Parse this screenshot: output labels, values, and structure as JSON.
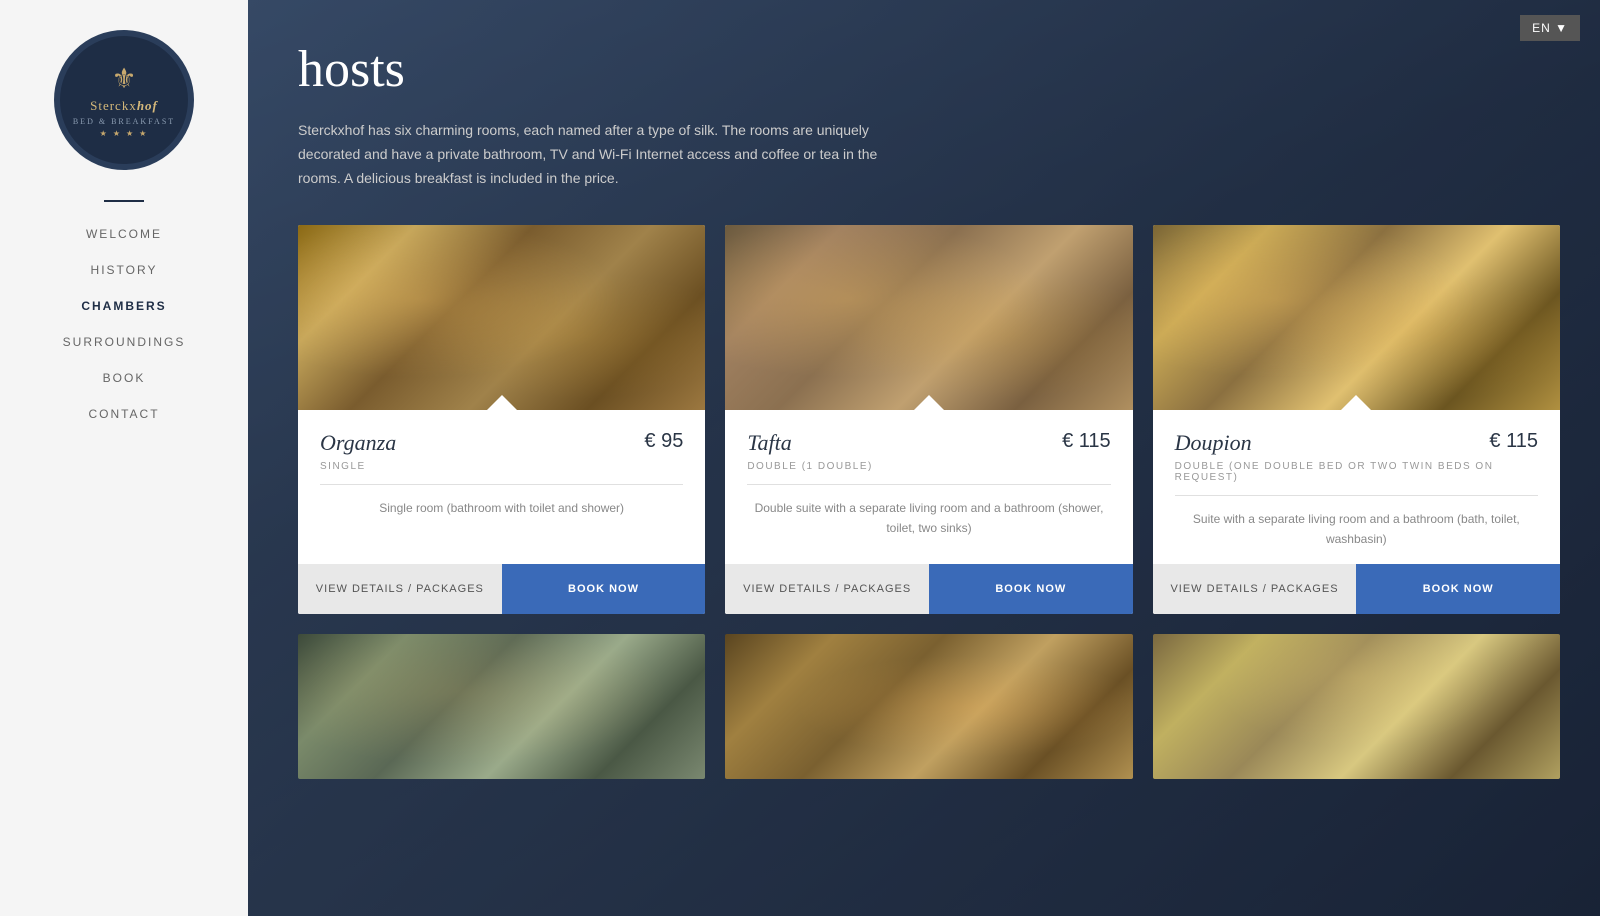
{
  "lang": {
    "selector": "EN ▼"
  },
  "sidebar": {
    "logo": {
      "crest": "⚜",
      "name_prefix": "Sterckx",
      "name_suffix": "hof",
      "subtitle": "BED & BREAKFAST",
      "stars": "★ ★ ★ ★"
    },
    "nav": [
      {
        "id": "welcome",
        "label": "WELCOME",
        "active": false
      },
      {
        "id": "history",
        "label": "HISTORY",
        "active": false
      },
      {
        "id": "chambers",
        "label": "CHAMBERS",
        "active": true
      },
      {
        "id": "surroundings",
        "label": "SURROUNDINGS",
        "active": false
      },
      {
        "id": "book",
        "label": "BOOK",
        "active": false
      },
      {
        "id": "contact",
        "label": "CONTACT",
        "active": false
      }
    ]
  },
  "main": {
    "title": "hosts",
    "description": "Sterckxhof has six charming rooms, each named after a type of silk. The rooms are uniquely decorated and have a private bathroom, TV and Wi-Fi Internet access and coffee or tea in the rooms. A delicious breakfast is included in the price.",
    "rooms": [
      {
        "id": "organza",
        "name": "Organza",
        "price": "€ 95",
        "type": "SINGLE",
        "description": "Single room (bathroom with toilet and shower)",
        "image_class": "organza"
      },
      {
        "id": "tafta",
        "name": "Tafta",
        "price": "€ 115",
        "type": "DOUBLE (1 DOUBLE)",
        "description": "Double suite with a separate living room and a bathroom (shower, toilet, two sinks)",
        "image_class": "tafta"
      },
      {
        "id": "doupion",
        "name": "Doupion",
        "price": "€ 115",
        "type": "DOUBLE (ONE DOUBLE BED OR TWO TWIN BEDS ON REQUEST)",
        "description": "Suite with a separate living room and a bathroom (bath, toilet, washbasin)",
        "image_class": "doupion"
      }
    ],
    "bottom_rooms": [
      {
        "id": "room4",
        "image_class": "room4"
      },
      {
        "id": "room5",
        "image_class": "room5"
      },
      {
        "id": "room6",
        "image_class": "room6"
      }
    ],
    "buttons": {
      "view_details": "VIEW DETAILS / PACKAGES",
      "book_now": "BOOK NOW"
    }
  }
}
